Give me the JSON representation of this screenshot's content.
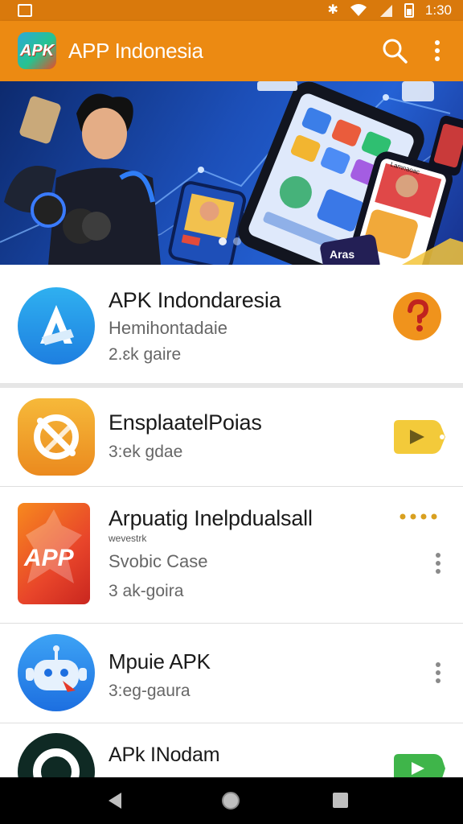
{
  "status_bar": {
    "time": "1:30",
    "icons": [
      "screenshot-icon",
      "bluetooth-icon",
      "wifi-icon",
      "signal-icon",
      "battery-icon"
    ]
  },
  "app_bar": {
    "logo_text": "APK",
    "title": "APP Indonesia",
    "icons": [
      "search-icon",
      "more-vert-icon"
    ],
    "color": "#ec8a12"
  },
  "banner": {
    "phone_tile_text": "Lamnaoac",
    "corner_text": "Aras",
    "pager_active_index": 0,
    "pager_count": 2
  },
  "apps": [
    {
      "title": "APK Indondaresia",
      "subtitle": "Hemihontadaie",
      "meta": "2.ɛk gaire",
      "action": "question-button-icon"
    },
    {
      "title": "EnsplaatelPoias",
      "subtitle": "",
      "meta": "3:ek gdae",
      "action": "play-tag-icon"
    },
    {
      "title": "Arpuatig Inelpdualsall",
      "tiny": "wevestrk",
      "subtitle": "Svobic Case",
      "meta": "3 ak-goira",
      "action": "more-vert-icon",
      "icon_text": "APP"
    },
    {
      "title": "Mpuie APK",
      "subtitle": "",
      "meta": "3:eg-gaura",
      "action": "more-vert-icon"
    },
    {
      "title": "APk INodam",
      "subtitle": "",
      "meta": "",
      "action": "play-tag-icon"
    }
  ],
  "nav_bar": {
    "icons": [
      "back-icon",
      "home-icon",
      "recents-icon"
    ]
  }
}
